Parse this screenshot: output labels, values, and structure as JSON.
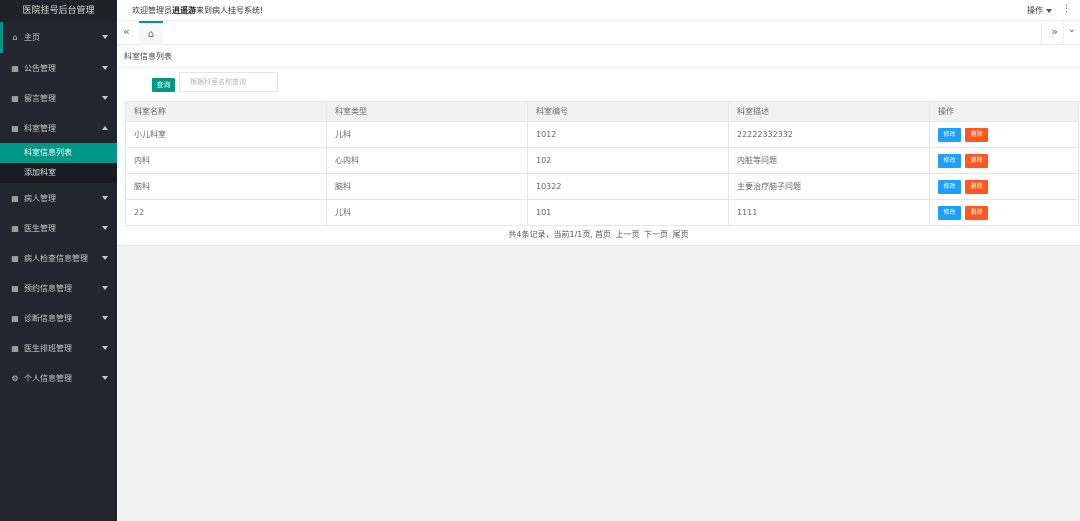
{
  "app": {
    "title": "医院挂号后台管理"
  },
  "header": {
    "welcome_prefix": "欢迎管理员",
    "admin_name": "逍遥游",
    "welcome_suffix": "来到病人挂号系统!",
    "ops_label": "操作"
  },
  "sidebar": {
    "items": [
      {
        "label": "主页",
        "icon": "home-icon"
      },
      {
        "label": "公告管理",
        "icon": "calendar-icon"
      },
      {
        "label": "留言管理",
        "icon": "calendar-icon"
      },
      {
        "label": "科室管理",
        "icon": "calendar-icon",
        "expanded": true
      },
      {
        "label": "病人管理",
        "icon": "calendar-icon"
      },
      {
        "label": "医生管理",
        "icon": "calendar-icon"
      },
      {
        "label": "病人检查信息管理",
        "icon": "calendar-icon"
      },
      {
        "label": "预约信息管理",
        "icon": "calendar-icon"
      },
      {
        "label": "诊断信息管理",
        "icon": "calendar-icon"
      },
      {
        "label": "医生排班管理",
        "icon": "calendar-icon"
      },
      {
        "label": "个人信息管理",
        "icon": "gear-icon"
      }
    ],
    "submenu": [
      {
        "label": "科室信息列表",
        "selected": true
      },
      {
        "label": "添加科室",
        "selected": false
      }
    ]
  },
  "breadcrumb": "科室信息列表",
  "search": {
    "button_label": "查询",
    "placeholder": "根据科室名称查询"
  },
  "table": {
    "headers": [
      "科室名称",
      "科室类型",
      "科室编号",
      "科室描述",
      "操作"
    ],
    "rows": [
      [
        "小儿科室",
        "儿科",
        "1012",
        "22222332332"
      ],
      [
        "内科",
        "心内科",
        "102",
        "内脏等问题"
      ],
      [
        "脑科",
        "脑科",
        "10322",
        "主要治疗脑子问题"
      ],
      [
        "22",
        "儿科",
        "101",
        "1111"
      ]
    ],
    "edit_label": "修改",
    "delete_label": "删除"
  },
  "pager": {
    "summary": "共4条记录，当前1/1页,",
    "first": "首页",
    "prev": "上一页",
    "next": "下一页",
    "last": "尾页"
  },
  "colors": {
    "accent": "#009688",
    "edit": "#1e9fff",
    "delete": "#ff5722",
    "sidebar_bg": "#23262e"
  }
}
